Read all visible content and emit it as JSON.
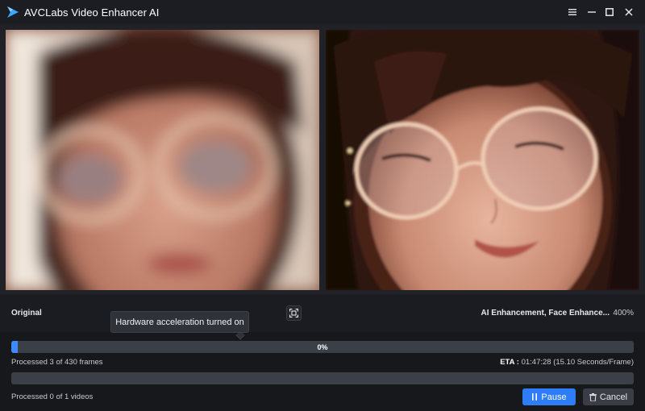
{
  "app": {
    "title": "AVCLabs Video Enhancer AI"
  },
  "colors": {
    "accent": "#2e7cf6",
    "background": "#1a1c21",
    "bar_track": "#3b3f47"
  },
  "titlebar": {
    "buttons": [
      "menu-icon",
      "minimize-icon",
      "maximize-icon",
      "close-icon"
    ]
  },
  "preview": {
    "left_label": "Original",
    "right_label": "AI Enhancement, Face Enhance...",
    "scale": "400%",
    "compare_icon": "fullscreen-compare-icon"
  },
  "tooltip": {
    "text": "Hardware acceleration turned on"
  },
  "progress": {
    "frames_percent_label": "0%",
    "frames_fill_fraction": 0.01,
    "frames_text": "Processed 3 of 430 frames",
    "eta_label": "ETA :",
    "eta_value": "01:47:28 (15.10 Seconds/Frame)",
    "videos_fill_fraction": 0,
    "videos_text": "Processed 0 of 1 videos"
  },
  "actions": {
    "pause_label": "Pause",
    "pause_icon": "pause-icon",
    "cancel_label": "Cancel",
    "cancel_icon": "trash-icon"
  }
}
